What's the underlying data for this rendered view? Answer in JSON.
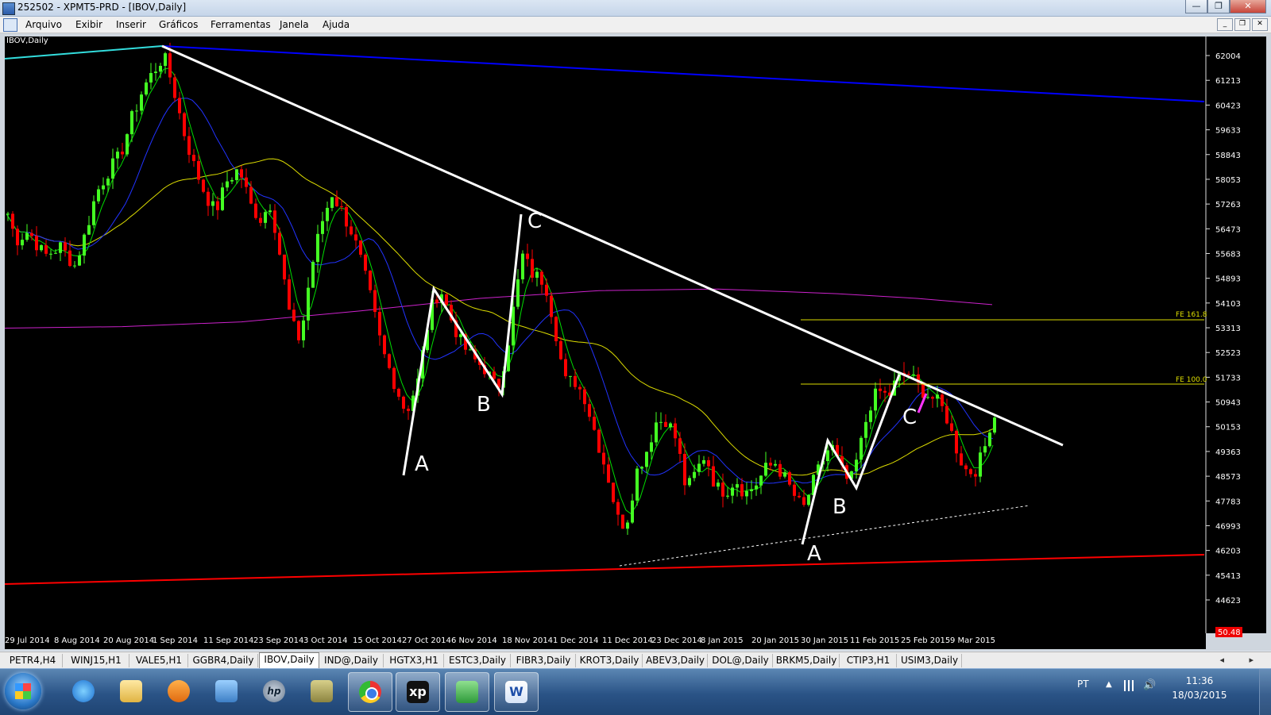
{
  "window": {
    "title": "252502 - XPMT5-PRD - [IBOV,Daily]",
    "btn_minimize": "—",
    "btn_restore": "❐",
    "btn_close": "✕"
  },
  "menu": {
    "items": [
      "Arquivo",
      "Exibir",
      "Inserir",
      "Gráficos",
      "Ferramentas",
      "Janela",
      "Ajuda"
    ]
  },
  "chart": {
    "symbol_label": "IBOV,Daily",
    "price_levels": [
      62004,
      61213,
      60423,
      59633,
      58843,
      58053,
      57263,
      56473,
      55683,
      54893,
      54103,
      53313,
      52523,
      51733,
      50943,
      50153,
      49363,
      48573,
      47783,
      46993,
      46203,
      45413,
      44623
    ],
    "current_price": "50.48",
    "date_labels": [
      "29 Jul 2014",
      "8 Aug 2014",
      "20 Aug 2014",
      "1 Sep 2014",
      "11 Sep 2014",
      "23 Sep 2014",
      "3 Oct 2014",
      "15 Oct 2014",
      "27 Oct 2014",
      "6 Nov 2014",
      "18 Nov 2014",
      "1 Dec 2014",
      "11 Dec 2014",
      "23 Dec 2014",
      "8 Jan 2015",
      "20 Jan 2015",
      "30 Jan 2015",
      "11 Feb 2015",
      "25 Feb 2015",
      "9 Mar 2015"
    ],
    "fibo_labels": [
      "FE 161.8",
      "FE 100.0"
    ],
    "wave_labels": [
      "A",
      "B",
      "C",
      "A",
      "B",
      "C"
    ],
    "colors": {
      "background": "#000000",
      "bull": "#44ff22",
      "bear": "#ff0000",
      "trendline": "#ffffff",
      "top_channel": "#0000ff",
      "bottom_channel": "#ff0000",
      "ma_fast": "#00dd00",
      "ma_blue": "#2233ff",
      "ma_yellow": "#dddd00",
      "ma_magenta": "#cc22cc"
    }
  },
  "tabs": {
    "items": [
      "PETR4,H4",
      "WINJ15,H1",
      "VALE5,H1",
      "GGBR4,Daily",
      "IBOV,Daily",
      "IND@,Daily",
      "HGTX3,H1",
      "ESTC3,Daily",
      "FIBR3,Daily",
      "KROT3,Daily",
      "ABEV3,Daily",
      "DOL@,Daily",
      "BRKM5,Daily",
      "CTIP3,H1",
      "USIM3,Daily"
    ],
    "active": "IBOV,Daily"
  },
  "taskbar": {
    "apps": [
      "start-button",
      "internet-explorer-icon",
      "file-explorer-icon",
      "media-player-icon",
      "network-app-icon",
      "hp-icon",
      "archive-icon",
      "chrome-icon",
      "xp-investimentos-icon",
      "metatrader-icon",
      "word-icon"
    ],
    "xp_label": "xp",
    "hp_label": "hp",
    "language": "PT",
    "time": "11:36",
    "date": "18/03/2015"
  }
}
